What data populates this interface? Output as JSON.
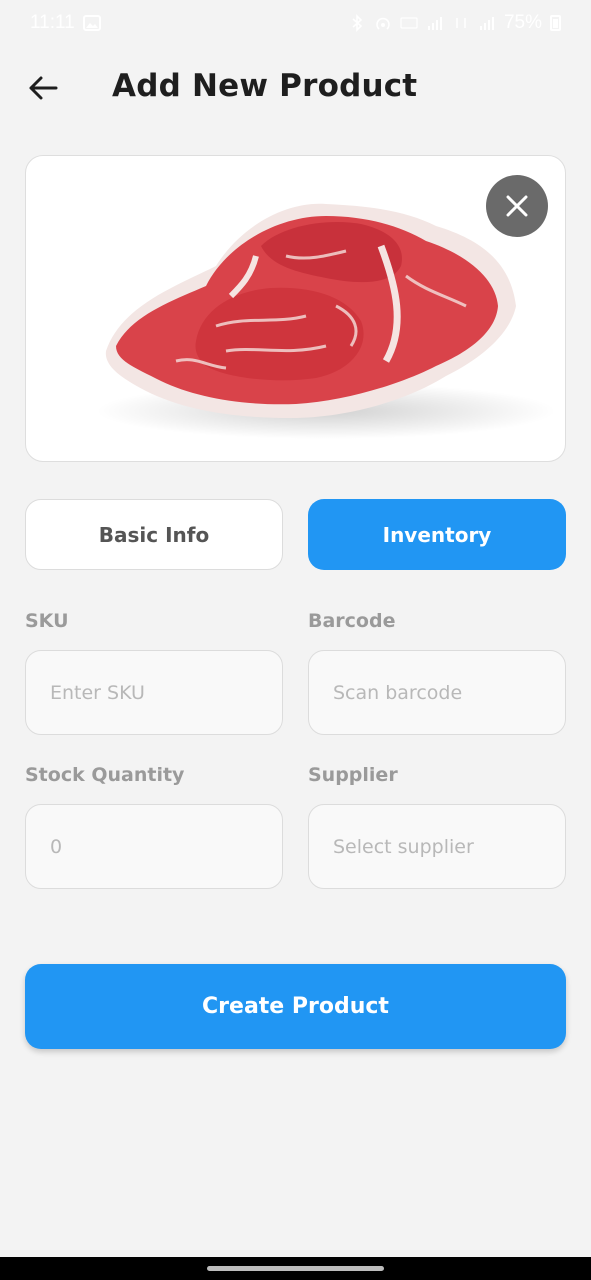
{
  "status_bar": {
    "time": "11:11",
    "battery": "75%",
    "icons": [
      "gallery-icon",
      "bluetooth-icon",
      "hotspot-icon",
      "volte-icon",
      "signal-icon",
      "lte-icon",
      "signal-icon",
      "battery-icon"
    ]
  },
  "header": {
    "title": "Add New Product",
    "back_icon": "back-arrow-icon"
  },
  "image": {
    "alt": "Raw ribeye steak",
    "remove_icon": "close-icon"
  },
  "tabs": [
    {
      "label": "Basic Info",
      "active": false
    },
    {
      "label": "Inventory",
      "active": true
    }
  ],
  "form": {
    "sku": {
      "label": "SKU",
      "placeholder": "Enter SKU",
      "value": ""
    },
    "barcode": {
      "label": "Barcode",
      "placeholder": "Scan barcode",
      "value": ""
    },
    "stock_quantity": {
      "label": "Stock Quantity",
      "placeholder": "0",
      "value": ""
    },
    "supplier": {
      "label": "Supplier",
      "placeholder": "Select supplier"
    }
  },
  "actions": {
    "create_label": "Create Product"
  },
  "colors": {
    "accent": "#2196f3",
    "background": "#f3f3f3",
    "label": "#9a9a9a"
  }
}
